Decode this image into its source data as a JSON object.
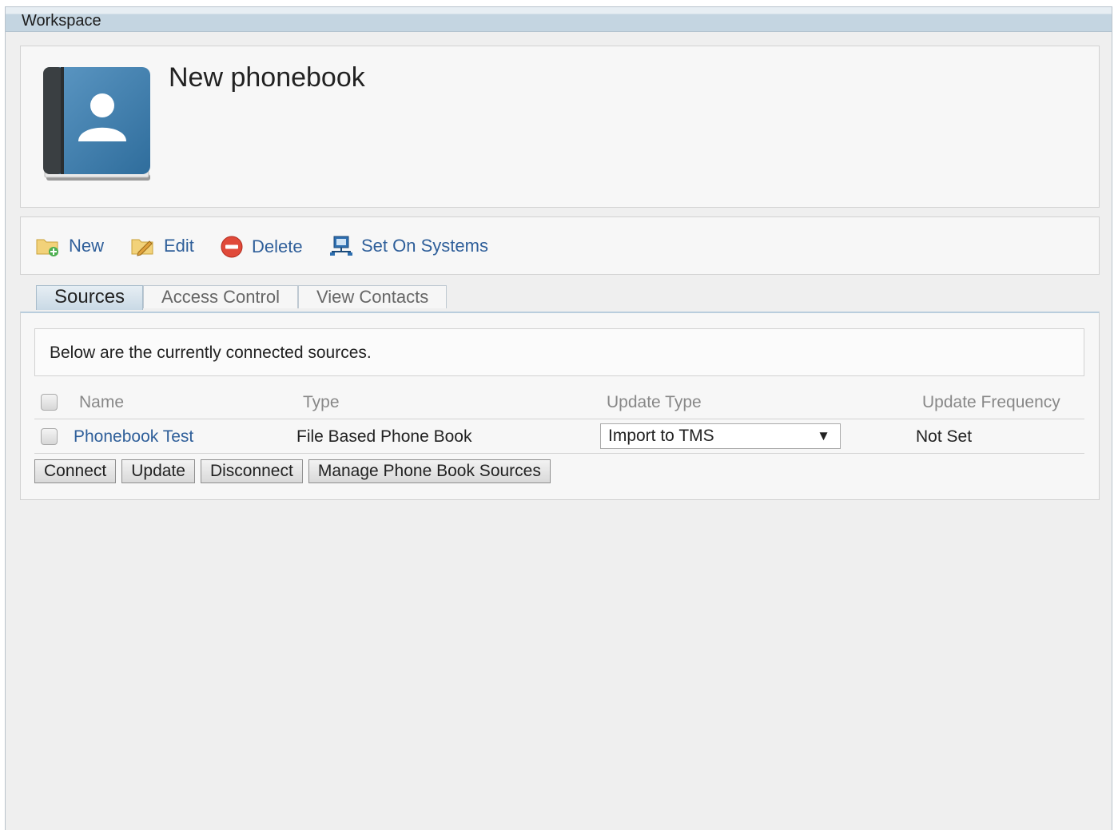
{
  "workspace": {
    "title": "Workspace"
  },
  "phonebook": {
    "name": "New phonebook"
  },
  "toolbar": {
    "new_label": "New",
    "edit_label": "Edit",
    "delete_label": "Delete",
    "set_on_systems_label": "Set On Systems"
  },
  "tabs": [
    {
      "label": "Sources",
      "active": true
    },
    {
      "label": "Access Control",
      "active": false
    },
    {
      "label": "View Contacts",
      "active": false
    }
  ],
  "sources": {
    "info_text": "Below are the currently connected sources.",
    "columns": {
      "name": "Name",
      "type": "Type",
      "update_type": "Update Type",
      "update_frequency": "Update Frequency"
    },
    "rows": [
      {
        "name": "Phonebook Test",
        "type": "File Based Phone Book",
        "update_type": "Import to TMS",
        "update_frequency": "Not Set"
      }
    ],
    "select_arrow": "▼"
  },
  "buttons": {
    "connect": "Connect",
    "update": "Update",
    "disconnect": "Disconnect",
    "manage": "Manage Phone Book Sources"
  },
  "colors": {
    "link": "#2f5f9a",
    "header_bg": "#c4d5e1",
    "book_cover": "#3f7fae"
  },
  "icons": {
    "phonebook": "phonebook-icon",
    "new": "new-folder-icon",
    "edit": "edit-folder-icon",
    "delete": "delete-icon",
    "set_on_systems": "systems-icon"
  }
}
